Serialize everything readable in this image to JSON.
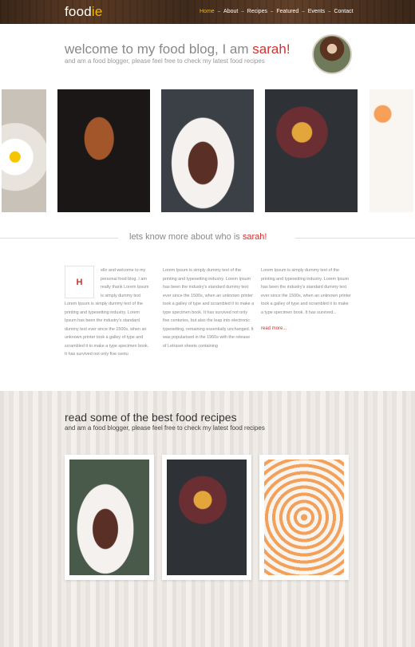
{
  "header": {
    "logo_main": "food",
    "logo_accent": "ie",
    "nav": [
      "Home",
      "About",
      "Recipes",
      "Featured",
      "Events",
      "Contact"
    ],
    "nav_separator": "–",
    "active_nav": "Home",
    "accent_color": "#f2b705"
  },
  "intro": {
    "title_prefix": "welcome to my food blog, I am ",
    "title_name": "sarah",
    "title_end": "!",
    "subtitle": "and am a food blogger, please feel free to check my latest food recipes"
  },
  "gallery": {
    "photos": [
      "fried-egg-toast",
      "croissant-and-nuts",
      "steak-with-asparagus",
      "fruit-platter",
      "fruit-tarts"
    ]
  },
  "about": {
    "title_prefix": "lets know more about who is ",
    "title_name": "sarah",
    "title_end": "!",
    "dropcap": "H",
    "col1_top": "ello and welcome to my personal food blog. I am really thank Lorem Ipsum is simply dummy text",
    "col1_rest": "Lorem Ipsum is simply dummy text of the printing and typesetting industry. Lorem Ipsum has been the industry's standard dummy text ever since the 1500s, when an unknown printer took a galley of type and scrambled it to make a type specimen book. It has survived not only five centu",
    "col2": "Lorem Ipsum is simply dummy text of the printing and typesetting industry. Lorem Ipsum has been the industry's standard dummy text ever since the 1500s, when an unknown printer took a galley of type and scrambled it to make a type specimen book. It has survived not only five centuries, but also the leap into electronic typesetting, remaining essentially unchanged. It was popularised in the 1960s with the release of Letraset sheets containing",
    "col3": "Lorem Ipsum is simply dummy text of the printing and typesetting industry. Lorem Ipsum has been the industry's standard dummy text ever since the 1500s, when an unknown printer took a galley of type and scrambled it to make a type specimen book. It has survived...",
    "read_more": "read more..."
  },
  "recipes": {
    "title": "read some of the best food recipes",
    "subtitle": "and am a food blogger, please feel free to check my latest food recipes",
    "cards": [
      "steak-with-asparagus",
      "fruit-platter",
      "fruit-tarts"
    ]
  }
}
